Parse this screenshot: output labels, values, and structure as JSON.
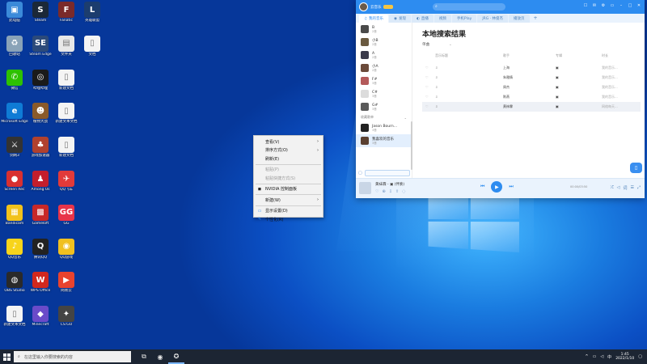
{
  "desktop": {
    "icons": [
      {
        "label": "此电脑",
        "glyph": "▣",
        "color": "#3b8ad9",
        "col": 0,
        "row": 0
      },
      {
        "label": "Steam",
        "glyph": "S",
        "color": "#1b2838",
        "col": 1,
        "row": 0
      },
      {
        "label": "Fanatic",
        "glyph": "F",
        "color": "#7a2a2a",
        "col": 2,
        "row": 0
      },
      {
        "label": "英雄联盟",
        "glyph": "L",
        "color": "#1c3d6e",
        "col": 3,
        "row": 0
      },
      {
        "label": "回收站",
        "glyph": "♻",
        "color": "#8aa3b8",
        "col": 0,
        "row": 1
      },
      {
        "label": "Steam Edge",
        "glyph": "SE",
        "color": "#2c4a7a",
        "col": 1,
        "row": 1
      },
      {
        "label": "文件夹",
        "glyph": "▤",
        "color": "#e8e8e8",
        "col": 2,
        "row": 1
      },
      {
        "label": "文档",
        "glyph": "▯",
        "color": "#f4f4f4",
        "col": 3,
        "row": 1
      },
      {
        "label": "微信",
        "glyph": "✆",
        "color": "#2dc100",
        "col": 0,
        "row": 2
      },
      {
        "label": "哔哩哔哩",
        "glyph": "◎",
        "color": "#1a1a1a",
        "col": 1,
        "row": 2
      },
      {
        "label": "新建文档",
        "glyph": "▯",
        "color": "#f4f4f4",
        "col": 2,
        "row": 2
      },
      {
        "label": "Microsoft Edge",
        "glyph": "e",
        "color": "#0f7bd5",
        "col": 0,
        "row": 3
      },
      {
        "label": "植物大战",
        "glyph": "☻",
        "color": "#8a5a2a",
        "col": 1,
        "row": 3
      },
      {
        "label": "新建文本文档",
        "glyph": "▯",
        "color": "#f4f4f4",
        "col": 2,
        "row": 3
      },
      {
        "label": "剑网3",
        "glyph": "⚔",
        "color": "#333",
        "col": 0,
        "row": 4
      },
      {
        "label": "游戏加速器",
        "glyph": "♣",
        "color": "#b0412e",
        "col": 1,
        "row": 4
      },
      {
        "label": "新建文档",
        "glyph": "▯",
        "color": "#f4f4f4",
        "col": 2,
        "row": 4
      },
      {
        "label": "Screen Rec",
        "glyph": "●",
        "color": "#d93030",
        "col": 0,
        "row": 5
      },
      {
        "label": "Among Us",
        "glyph": "♟",
        "color": "#c31e2c",
        "col": 1,
        "row": 5
      },
      {
        "label": "QQ飞车",
        "glyph": "✈",
        "color": "#e23a3a",
        "col": 2,
        "row": 5
      },
      {
        "label": "Bandicam",
        "glyph": "▦",
        "color": "#f2c21b",
        "col": 0,
        "row": 6
      },
      {
        "label": "Gameloft",
        "glyph": "▩",
        "color": "#c82828",
        "col": 1,
        "row": 6
      },
      {
        "label": "GG",
        "glyph": "GG",
        "color": "#e8344a",
        "col": 2,
        "row": 6
      },
      {
        "label": "QQ音乐",
        "glyph": "♪",
        "color": "#f7d41a",
        "col": 0,
        "row": 7
      },
      {
        "label": "腾讯QQ",
        "glyph": "Q",
        "color": "#222",
        "col": 1,
        "row": 7
      },
      {
        "label": "QQ游戏",
        "glyph": "◉",
        "color": "#f0c020",
        "col": 2,
        "row": 7
      },
      {
        "label": "OBS Studio",
        "glyph": "◍",
        "color": "#2a2a2a",
        "col": 0,
        "row": 8
      },
      {
        "label": "WPS Office",
        "glyph": "W",
        "color": "#d2281e",
        "col": 1,
        "row": 8
      },
      {
        "label": "网易云",
        "glyph": "▶",
        "color": "#e8432e",
        "col": 2,
        "row": 8
      },
      {
        "label": "新建文本文档",
        "glyph": "▯",
        "color": "#f4f4f4",
        "col": 0,
        "row": 9
      },
      {
        "label": "Minecraft",
        "glyph": "◆",
        "color": "#6a4bc9",
        "col": 1,
        "row": 9
      },
      {
        "label": "CS:GO",
        "glyph": "✦",
        "color": "#444",
        "col": 2,
        "row": 9
      }
    ]
  },
  "context_menu": {
    "items": [
      {
        "label": "查看(V)",
        "submenu": true,
        "disabled": false,
        "icon": ""
      },
      {
        "label": "排序方式(O)",
        "submenu": true,
        "disabled": false,
        "icon": ""
      },
      {
        "label": "刷新(E)",
        "submenu": false,
        "disabled": false,
        "icon": ""
      },
      {
        "sep": true
      },
      {
        "label": "粘贴(P)",
        "submenu": false,
        "disabled": true,
        "icon": ""
      },
      {
        "label": "粘贴快捷方式(S)",
        "submenu": false,
        "disabled": true,
        "icon": ""
      },
      {
        "sep": true
      },
      {
        "label": "NVIDIA 控制面板",
        "submenu": false,
        "disabled": false,
        "icon": "nvidia-icon"
      },
      {
        "sep": true
      },
      {
        "label": "新建(W)",
        "submenu": true,
        "disabled": false,
        "icon": ""
      },
      {
        "sep": true
      },
      {
        "label": "显示设置(D)",
        "submenu": false,
        "disabled": false,
        "icon": "display-icon"
      },
      {
        "label": "个性化(R)",
        "submenu": false,
        "disabled": false,
        "icon": "personalize-icon"
      }
    ]
  },
  "music_app": {
    "user_name": "云音乐",
    "tabs": [
      {
        "label": "我的音乐",
        "icon": "♫",
        "active": true
      },
      {
        "label": "发现",
        "icon": "◉",
        "active": false
      },
      {
        "label": "直播",
        "icon": "◐",
        "active": false
      },
      {
        "label": "视频",
        "icon": "",
        "active": false
      },
      {
        "label": "手机Play",
        "icon": "",
        "active": false
      },
      {
        "label": "JRG · 林俊杰",
        "icon": "",
        "active": false
      },
      {
        "label": "播放页",
        "icon": "",
        "active": false
      }
    ],
    "playlists": [
      {
        "name": "B",
        "count": "2首",
        "color": "#4a4a4a"
      },
      {
        "name": "小B",
        "count": "2首",
        "color": "#6a5a40"
      },
      {
        "name": "A",
        "count": "2首",
        "color": "#3a3a4a"
      },
      {
        "name": "小A",
        "count": "2首",
        "color": "#6b4a3a"
      },
      {
        "name": "F#",
        "count": "3首",
        "color": "#b45a5a"
      },
      {
        "name": "C#",
        "count": "3首",
        "color": "#dcdcdc"
      },
      {
        "name": "G#",
        "count": "3首",
        "color": "#5a5a5a"
      }
    ],
    "collected_section": "收藏歌单",
    "collected": [
      {
        "name": "Jason Bourn...",
        "count": "3首",
        "color": "#222",
        "selected": false
      },
      {
        "name": "我喜欢的音乐",
        "count": "3首",
        "color": "#5a4030",
        "selected": true
      }
    ],
    "main_title": "本地搜索结果",
    "sort_label": "单曲",
    "columns": [
      "音乐标题",
      "歌手",
      "专辑",
      "时长"
    ],
    "rows": [
      {
        "title": "",
        "artist": "上海",
        "album": "",
        "duration": "我的音乐...",
        "highlight": false
      },
      {
        "title": "",
        "artist": "朱雅情",
        "album": "",
        "duration": "我的音乐...",
        "highlight": false
      },
      {
        "title": "",
        "artist": "周杰",
        "album": "",
        "duration": "我的音乐...",
        "highlight": false
      },
      {
        "title": "",
        "artist": "陈燕",
        "album": "",
        "duration": "我的音乐...",
        "highlight": false
      },
      {
        "title": "",
        "artist": "黄袜霖",
        "album": "",
        "duration": "网络每天...",
        "highlight": true
      }
    ],
    "player": {
      "song": "黄袜霖 - ▣ (伴奏)",
      "time": "00:00/03:50"
    }
  },
  "taskbar": {
    "search_placeholder": "在这里输入你要搜索的内容",
    "time": "1:45",
    "date": "2022/1/10"
  }
}
